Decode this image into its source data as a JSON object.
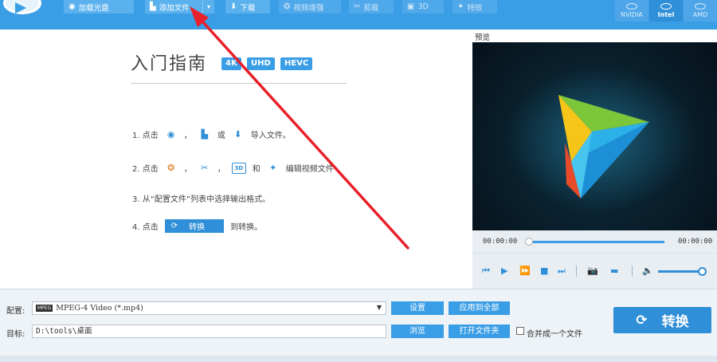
{
  "toolbar": {
    "load_disc": "加载光盘",
    "add_file": "添加文件",
    "dropdown_glyph": "▾",
    "download": "下载",
    "enhance": "视频增强",
    "cut": "剪裁",
    "three_d": "3D",
    "effects": "特效"
  },
  "hardware": {
    "nvidia": "NVIDIA",
    "intel": "Intel",
    "amd": "AMD",
    "intel_logo": "intel"
  },
  "guide": {
    "title": "入门指南",
    "badges": [
      "4K",
      "UHD",
      "HEVC"
    ],
    "step1": {
      "num": "1. 点击",
      "sep1": "，",
      "or": "或",
      "suffix": "导入文件。"
    },
    "step2": {
      "num": "2. 点击",
      "sep1": "，",
      "sep2": "，",
      "and": "和",
      "suffix": "编辑视频文件"
    },
    "step3": "3. 从“配置文件”列表中选择输出格式。",
    "step4": {
      "num": "4. 点击",
      "button": "转换",
      "suffix": "到转换。"
    },
    "icon_3d": "3D"
  },
  "preview": {
    "label": "预览",
    "time_start": "00:00:00",
    "time_end": "00:00:00"
  },
  "bottom": {
    "profile_label": "配置:",
    "profile_value": "MPEG-4 Video (*.mp4)",
    "profile_icon_text": "MPEG",
    "target_label": "目标:",
    "target_value": "D:\\tools\\桌面",
    "settings": "设置",
    "apply_all": "应用到全部",
    "browse": "浏览",
    "open_folder": "打开文件夹",
    "merge": "合并成一个文件",
    "convert": "转换"
  },
  "icons": {
    "refresh": "⟳",
    "prev": "⏮",
    "play": "▶",
    "forward": "⏩",
    "stop": "■",
    "next": "⏭",
    "camera": "📷",
    "folder": "▬",
    "volume": "🔈"
  },
  "colors": {
    "accent": "#3a9ee6",
    "dark_accent": "#2f8fd8",
    "annotation_arrow": "#e8202a"
  }
}
